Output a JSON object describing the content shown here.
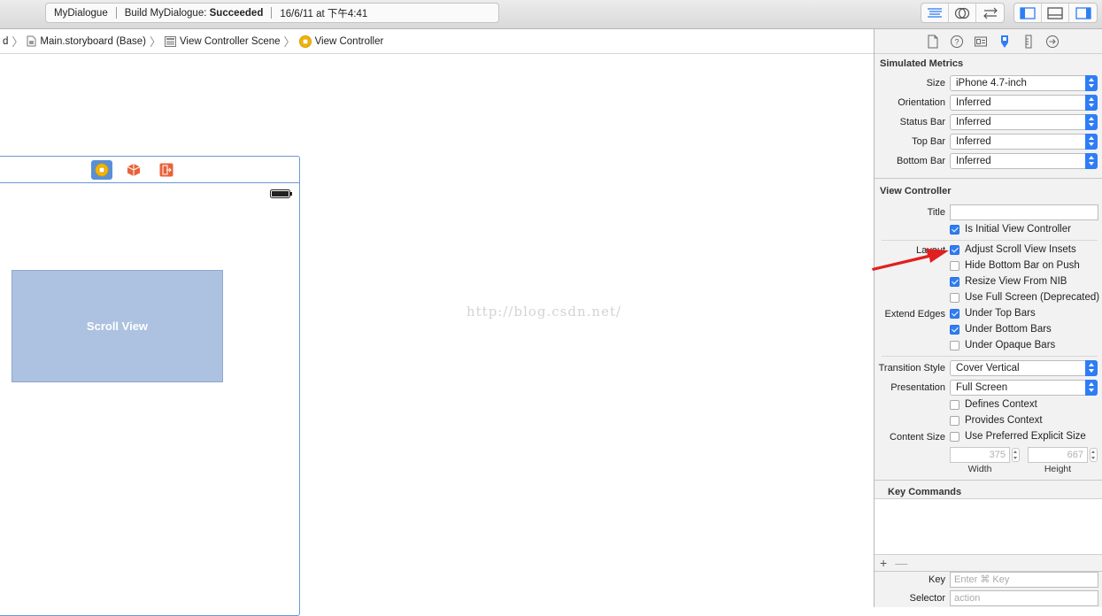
{
  "toolbar": {
    "app_name": "MyDialogue",
    "build_prefix": "Build MyDialogue: ",
    "build_status": "Succeeded",
    "timestamp": "16/6/11 at 下午4:41",
    "editor_buttons": [
      "standard-editor-icon",
      "assistant-editor-icon",
      "version-editor-icon"
    ],
    "view_buttons": [
      "navigator-toggle-icon",
      "debug-area-toggle-icon",
      "utilities-toggle-icon"
    ],
    "accent_color": "#2f7df6"
  },
  "jumpbar": {
    "crumbs": [
      {
        "label": "d",
        "icon": ""
      },
      {
        "label": "Main.storyboard (Base)",
        "icon": "storyboard-file-icon"
      },
      {
        "label": "View Controller Scene",
        "icon": "scene-icon"
      },
      {
        "label": "View Controller",
        "icon": "view-controller-icon"
      }
    ]
  },
  "canvas": {
    "scroll_view_label": "Scroll View",
    "watermark": "http://blog.csdn.net/",
    "dock_icons": [
      "view-controller-icon",
      "first-responder-icon",
      "exit-icon"
    ]
  },
  "inspector": {
    "tabs": [
      "file-inspector-icon",
      "quick-help-icon",
      "identity-inspector-icon",
      "attributes-inspector-icon",
      "size-inspector-icon",
      "connections-inspector-icon"
    ],
    "simulated_metrics": {
      "title": "Simulated Metrics",
      "rows": [
        {
          "label": "Size",
          "value": "iPhone 4.7-inch"
        },
        {
          "label": "Orientation",
          "value": "Inferred"
        },
        {
          "label": "Status Bar",
          "value": "Inferred"
        },
        {
          "label": "Top Bar",
          "value": "Inferred"
        },
        {
          "label": "Bottom Bar",
          "value": "Inferred"
        }
      ]
    },
    "view_controller": {
      "title": "View Controller",
      "title_label": "Title",
      "title_value": "",
      "initial_vc": {
        "label": "Is Initial View Controller",
        "checked": true
      },
      "layout_label": "Layout",
      "layout_options": [
        {
          "label": "Adjust Scroll View Insets",
          "checked": true
        },
        {
          "label": "Hide Bottom Bar on Push",
          "checked": false
        },
        {
          "label": "Resize View From NIB",
          "checked": true
        },
        {
          "label": "Use Full Screen (Deprecated)",
          "checked": false
        }
      ],
      "extend_edges_label": "Extend Edges",
      "extend_edges_options": [
        {
          "label": "Under Top Bars",
          "checked": true
        },
        {
          "label": "Under Bottom Bars",
          "checked": true
        },
        {
          "label": "Under Opaque Bars",
          "checked": false
        }
      ],
      "transition_style_label": "Transition Style",
      "transition_style_value": "Cover Vertical",
      "presentation_label": "Presentation",
      "presentation_value": "Full Screen",
      "defines_context": {
        "label": "Defines Context",
        "checked": false
      },
      "provides_context": {
        "label": "Provides Context",
        "checked": false
      },
      "content_size_label": "Content Size",
      "preferred_size": {
        "label": "Use Preferred Explicit Size",
        "checked": false
      },
      "width_value": "375",
      "height_value": "667",
      "width_label": "Width",
      "height_label": "Height"
    },
    "key_commands": {
      "title": "Key Commands",
      "add": "+",
      "remove": "—",
      "key_label": "Key",
      "key_placeholder": "Enter ⌘ Key",
      "selector_label": "Selector",
      "selector_placeholder": "action"
    }
  },
  "annotation": {
    "arrow_color": "#e02020",
    "target": "Adjust Scroll View Insets"
  }
}
